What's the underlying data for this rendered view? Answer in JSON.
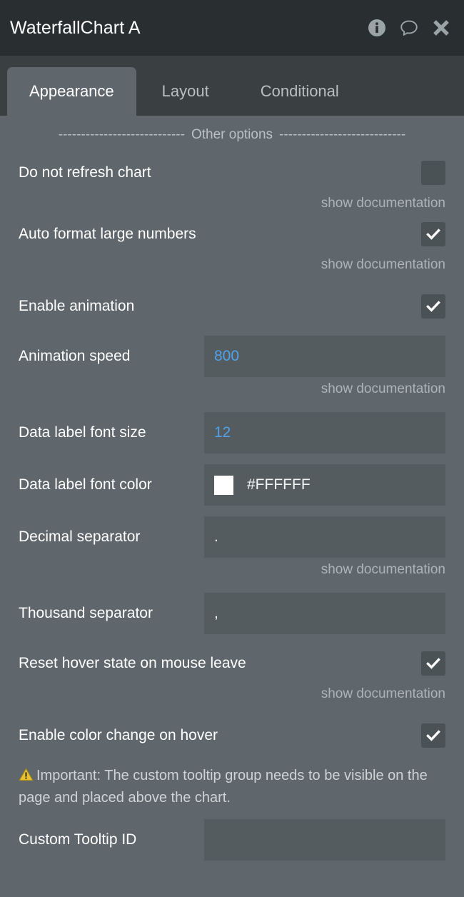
{
  "window": {
    "title": "WaterfallChart A",
    "icons": [
      {
        "name": "info-icon",
        "label": "Information"
      },
      {
        "name": "comment-icon",
        "label": "Comments"
      },
      {
        "name": "close-icon",
        "label": "Close"
      }
    ]
  },
  "tabs": [
    {
      "label": "Appearance",
      "active": true
    },
    {
      "label": "Layout",
      "active": false
    },
    {
      "label": "Conditional",
      "active": false
    }
  ],
  "section": {
    "dashes_left": "----------------------------",
    "title": "Other options",
    "dashes_right": "----------------------------"
  },
  "doc_link_label": "show documentation",
  "settings": {
    "do_not_refresh_chart": {
      "label": "Do not refresh chart",
      "type": "checkbox",
      "checked": false,
      "doc": true
    },
    "auto_format_large_numbers": {
      "label": "Auto format large numbers",
      "type": "checkbox",
      "checked": true,
      "doc": true
    },
    "enable_animation": {
      "label": "Enable animation",
      "type": "checkbox",
      "checked": true,
      "doc": false
    },
    "animation_speed": {
      "label": "Animation speed",
      "type": "text",
      "value": "800",
      "doc": true
    },
    "data_label_font_size": {
      "label": "Data label font size",
      "type": "text",
      "value": "12",
      "doc": false
    },
    "data_label_font_color": {
      "label": "Data label font color",
      "type": "color",
      "value": "#FFFFFF",
      "swatch": "#FFFFFF",
      "doc": false
    },
    "decimal_separator": {
      "label": "Decimal separator",
      "type": "text",
      "value": ".",
      "doc": true
    },
    "thousand_separator": {
      "label": "Thousand separator",
      "type": "text",
      "value": ",",
      "doc": false
    },
    "reset_hover_state": {
      "label": "Reset hover state on mouse leave",
      "type": "checkbox",
      "checked": true,
      "doc": true
    },
    "enable_color_change_on_hover": {
      "label": "Enable color change on hover",
      "type": "checkbox",
      "checked": true,
      "doc": false
    },
    "custom_tooltip_id": {
      "label": "Custom Tooltip ID",
      "type": "text",
      "value": "",
      "doc": false
    }
  },
  "important_note": {
    "icon": "warning-triangle-icon",
    "text": "Important: The custom tooltip group needs to be visible on the page and placed above the chart."
  },
  "colors": {
    "header_bg": "#292f31",
    "tabbar_bg": "#3a4042",
    "body_bg": "#5f676c",
    "field_bg": "#555c60",
    "checkbox_bg": "#4b5256",
    "value_blue": "#4fa2e8",
    "muted_text": "#adb4b7",
    "warning_yellow": "#e8c030"
  }
}
